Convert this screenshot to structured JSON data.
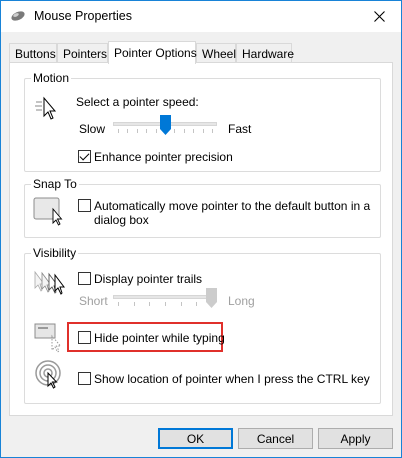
{
  "window": {
    "title": "Mouse Properties"
  },
  "tabs": [
    "Buttons",
    "Pointers",
    "Pointer Options",
    "Wheel",
    "Hardware"
  ],
  "motion": {
    "group_label": "Motion",
    "speed_label": "Select a pointer speed:",
    "slow_label": "Slow",
    "fast_label": "Fast",
    "speed_value": 0.5,
    "precision_label": "Enhance pointer precision",
    "precision_checked": true
  },
  "snap_to": {
    "group_label": "Snap To",
    "auto_move_label_line1": "Automatically move pointer to the default button in a",
    "auto_move_label_line2": "dialog box",
    "auto_move_checked": false
  },
  "visibility": {
    "group_label": "Visibility",
    "trails_label": "Display pointer trails",
    "trails_checked": false,
    "short_label": "Short",
    "long_label": "Long",
    "trails_value": 1.0,
    "hide_label": "Hide pointer while typing",
    "hide_checked": false,
    "show_location_label": "Show location of pointer when I press the CTRL key",
    "show_location_checked": false
  },
  "buttons": {
    "ok": "OK",
    "cancel": "Cancel",
    "apply": "Apply"
  },
  "colors": {
    "highlight": "#e0302b",
    "accent": "#0078d7",
    "thumb": "#0078d7"
  }
}
